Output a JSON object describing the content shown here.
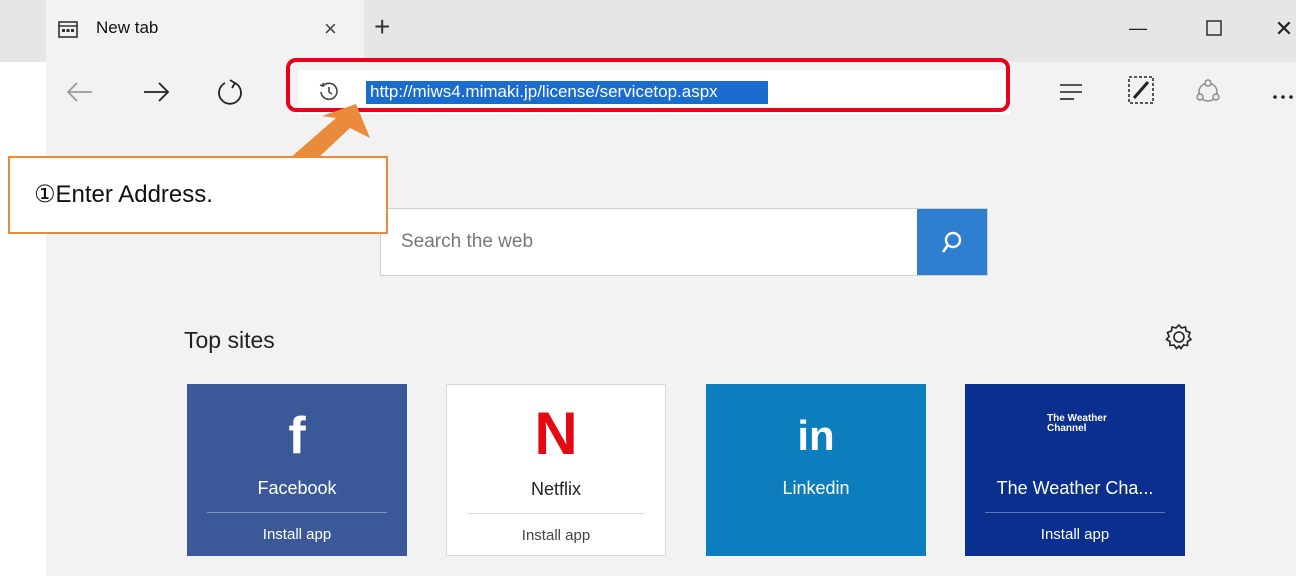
{
  "tab": {
    "title": "New tab",
    "close_glyph": "×"
  },
  "tabstrip": {
    "new_tab_glyph": "+"
  },
  "window": {
    "minimize_glyph": "—",
    "close_glyph": "✕"
  },
  "address_bar": {
    "url": "http://miws4.mimaki.jp/license/servicetop.aspx"
  },
  "callout": {
    "text": "①Enter Address."
  },
  "search": {
    "placeholder": "Search the web"
  },
  "top_sites": {
    "title": "Top sites",
    "tiles": [
      {
        "name": "Facebook",
        "logo": "f",
        "install": "Install app",
        "bg": "#3b5998",
        "fg": "#ffffff"
      },
      {
        "name": "Netflix",
        "logo": "N",
        "install": "Install app",
        "bg": "#ffffff",
        "fg": "#222222"
      },
      {
        "name": "Linkedin",
        "logo": "in",
        "install": "",
        "bg": "#0d7ebd",
        "fg": "#ffffff"
      },
      {
        "name": "The Weather Cha...",
        "logo": "The Weather Channel",
        "install": "Install app",
        "bg": "#0b2f8f",
        "fg": "#ffffff"
      }
    ]
  },
  "colors": {
    "accent": "#2f7fd0",
    "highlight_ring": "#e8001c",
    "callout_arrow": "#e98b3a",
    "netflix_red": "#e50914"
  },
  "icons": [
    "tab-page-icon",
    "back-arrow-icon",
    "forward-arrow-icon",
    "refresh-icon",
    "history-icon",
    "hub-icon",
    "web-note-icon",
    "share-icon",
    "more-icon",
    "search-icon",
    "gear-icon"
  ]
}
